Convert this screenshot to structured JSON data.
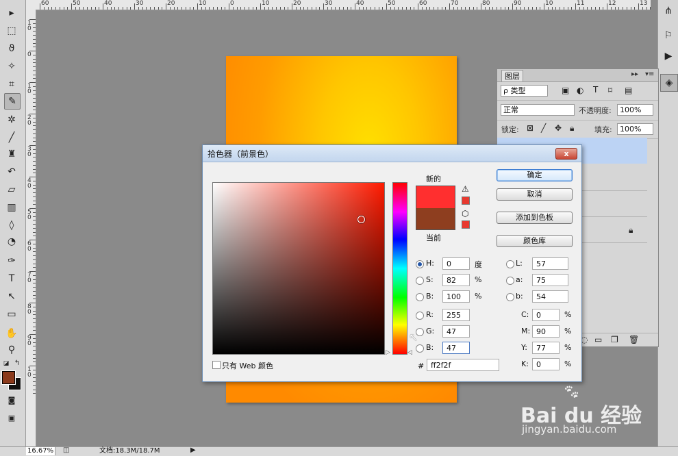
{
  "ruler": {
    "top_labels": [
      "60",
      "50",
      "40",
      "30",
      "20",
      "10",
      "0",
      "10",
      "20",
      "30",
      "40",
      "50",
      "60",
      "70",
      "80",
      "90",
      "10",
      "11",
      "12",
      "13"
    ],
    "left_labels": [
      "1 0",
      "0",
      "1 0",
      "2 0",
      "3 0",
      "4 0",
      "5 0",
      "6 0",
      "7 0",
      "8 0",
      "9 0",
      "1 0"
    ]
  },
  "toolbar": {
    "tools": [
      "move-icon",
      "marquee-icon",
      "lasso-icon",
      "magic-wand-icon",
      "crop-icon",
      "eyedropper-icon",
      "spot-heal-icon",
      "brush-icon",
      "stamp-icon",
      "history-brush-icon",
      "eraser-icon",
      "gradient-icon",
      "blur-icon",
      "dodge-icon",
      "pen-icon",
      "text-icon",
      "path-select-icon",
      "shape-icon",
      "hand-icon",
      "zoom-icon"
    ],
    "fg_color": "#8b3a1c",
    "bg_color": "#111111"
  },
  "layers": {
    "tab": "图层",
    "filter_label": "ρ 类型",
    "blend_mode": "正常",
    "opacity_label": "不透明度:",
    "opacity_value": "100%",
    "lock_label": "锁定:",
    "fill_label": "填充:",
    "fill_value": "100%"
  },
  "color_picker": {
    "title": "拾色器（前景色）",
    "close": "x",
    "new_label": "新的",
    "current_label": "当前",
    "new_color": "#ff2f2f",
    "current_color": "#8e3e1f",
    "buttons": {
      "ok": "确定",
      "cancel": "取消",
      "add_to_swatches": "添加到色板",
      "color_libraries": "颜色库"
    },
    "hsb": {
      "h_label": "H:",
      "h_value": "0",
      "h_unit": "度",
      "s_label": "S:",
      "s_value": "82",
      "s_unit": "%",
      "b_label": "B:",
      "b_value": "100",
      "b_unit": "%"
    },
    "rgb": {
      "r_label": "R:",
      "r_value": "255",
      "g_label": "G:",
      "g_value": "47",
      "b_label": "B:",
      "b_value": "47"
    },
    "lab": {
      "l_label": "L:",
      "l_value": "57",
      "a_label": "a:",
      "a_value": "75",
      "b_label": "b:",
      "b_value": "54"
    },
    "cmyk": {
      "c_label": "C:",
      "c_value": "0",
      "m_label": "M:",
      "m_value": "90",
      "y_label": "Y:",
      "y_value": "77",
      "k_label": "K:",
      "k_value": "0",
      "unit": "%"
    },
    "web_only_label": "只有 Web 颜色",
    "hex_label": "#",
    "hex_value": "ff2f2f"
  },
  "status": {
    "zoom": "16.67%",
    "doc_info": "文档:18.3M/18.7M"
  },
  "watermark": {
    "main": "Bai du 经验",
    "sub": "jingyan.baidu.com"
  }
}
